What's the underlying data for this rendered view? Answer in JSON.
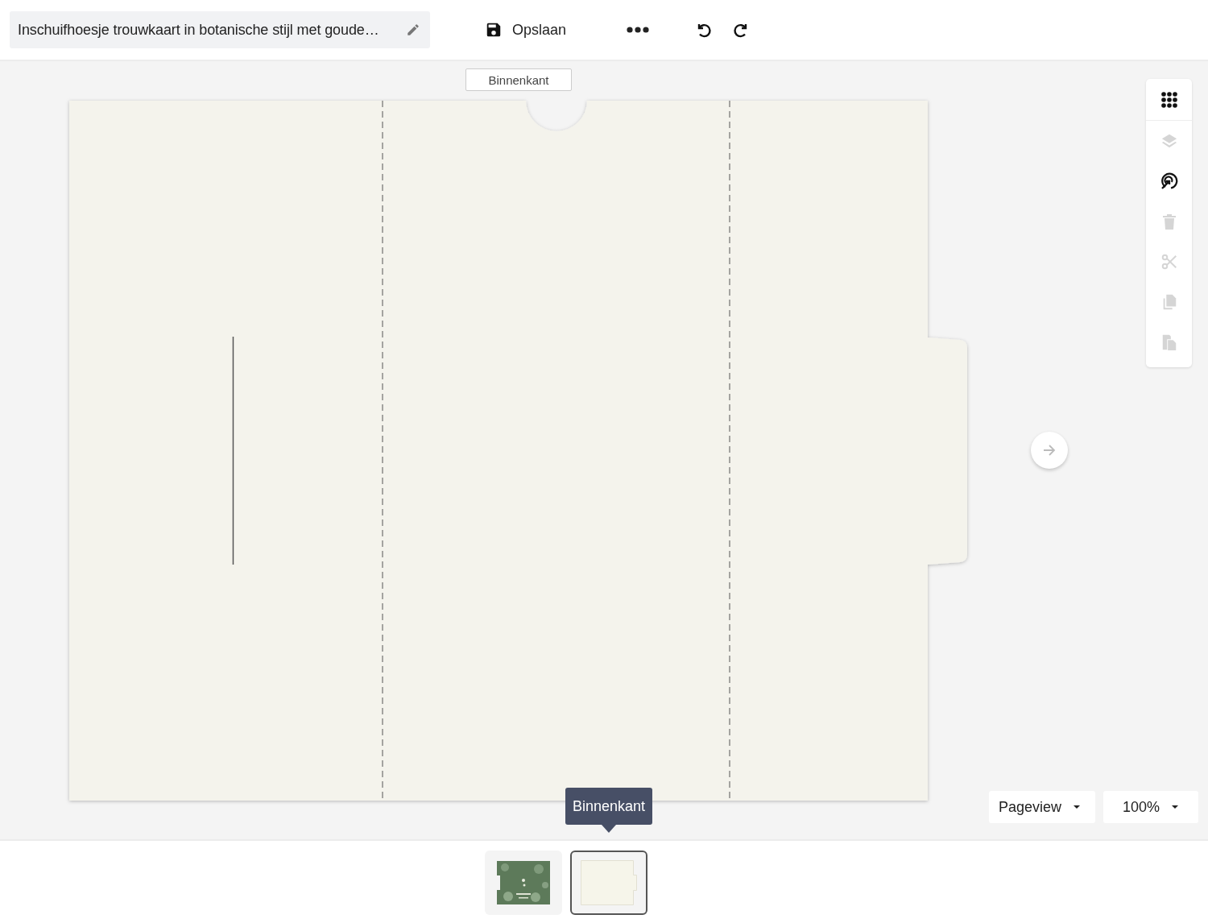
{
  "header": {
    "title": "Inschuifhoesje trouwkaart in botanische stijl met goude…",
    "save_label": "Opslaan"
  },
  "side_label": "Binnenkant",
  "tools": [
    {
      "kind": "grid",
      "disabled": false
    },
    {
      "kind": "layers",
      "disabled": true
    },
    {
      "kind": "target",
      "disabled": false
    },
    {
      "kind": "trash",
      "disabled": true
    },
    {
      "kind": "scissors",
      "disabled": true
    },
    {
      "kind": "copy",
      "disabled": true
    },
    {
      "kind": "paste",
      "disabled": true
    }
  ],
  "view_mode": "Pageview",
  "zoom": "100%",
  "tooltip": "Binnenkant",
  "thumbnails": [
    {
      "kind": "picture",
      "selected": false
    },
    {
      "kind": "card",
      "selected": true
    }
  ]
}
